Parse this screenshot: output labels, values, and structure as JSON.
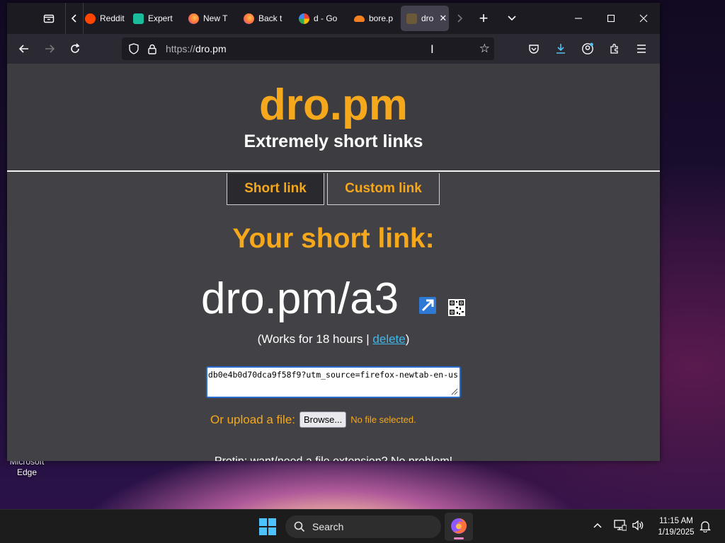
{
  "browser": {
    "tabs": [
      {
        "label": "Reddit",
        "favicon_color": "#ff4500",
        "icon": "reddit-icon"
      },
      {
        "label": "Expert",
        "favicon_color": "#1abc9c",
        "icon": "expert-icon"
      },
      {
        "label": "New T",
        "favicon_color": "#ff7139",
        "icon": "firefox-icon"
      },
      {
        "label": "Back t",
        "favicon_color": "#ff7139",
        "icon": "firefox-icon"
      },
      {
        "label": "d - Go",
        "favicon_color": "#4285f4",
        "icon": "google-icon"
      },
      {
        "label": "bore.p",
        "favicon_color": "#f48120",
        "icon": "cloud-icon"
      },
      {
        "label": "dro",
        "favicon_color": "#6b5a3a",
        "icon": "dro-icon",
        "active": true
      }
    ],
    "url_protocol": "https://",
    "url_host": "dro.pm"
  },
  "site": {
    "logo": "dro.pm",
    "tagline": "Extremely short links",
    "tab_short": "Short link",
    "tab_custom": "Custom link",
    "heading": "Your short link:",
    "short_link": "dro.pm/a3",
    "works_prefix": "(Works for 18 hours | ",
    "delete_label": "delete",
    "works_suffix": ")",
    "url_value": "db0e4b0d70dca9f58f9?utm_source=firefox-newtab-en-us",
    "upload_label": "Or upload a file:",
    "browse_label": "Browse...",
    "no_file": "No file selected.",
    "protip": "Protip: want/need a file extension? No problem!"
  },
  "desktop": {
    "icon_label_1": "Microsoft",
    "icon_label_2": "Edge"
  },
  "taskbar": {
    "search_label": "Search",
    "time": "11:15 AM",
    "date": "1/19/2025"
  },
  "colors": {
    "accent": "#f5a81c",
    "link": "#3fb8ec"
  }
}
